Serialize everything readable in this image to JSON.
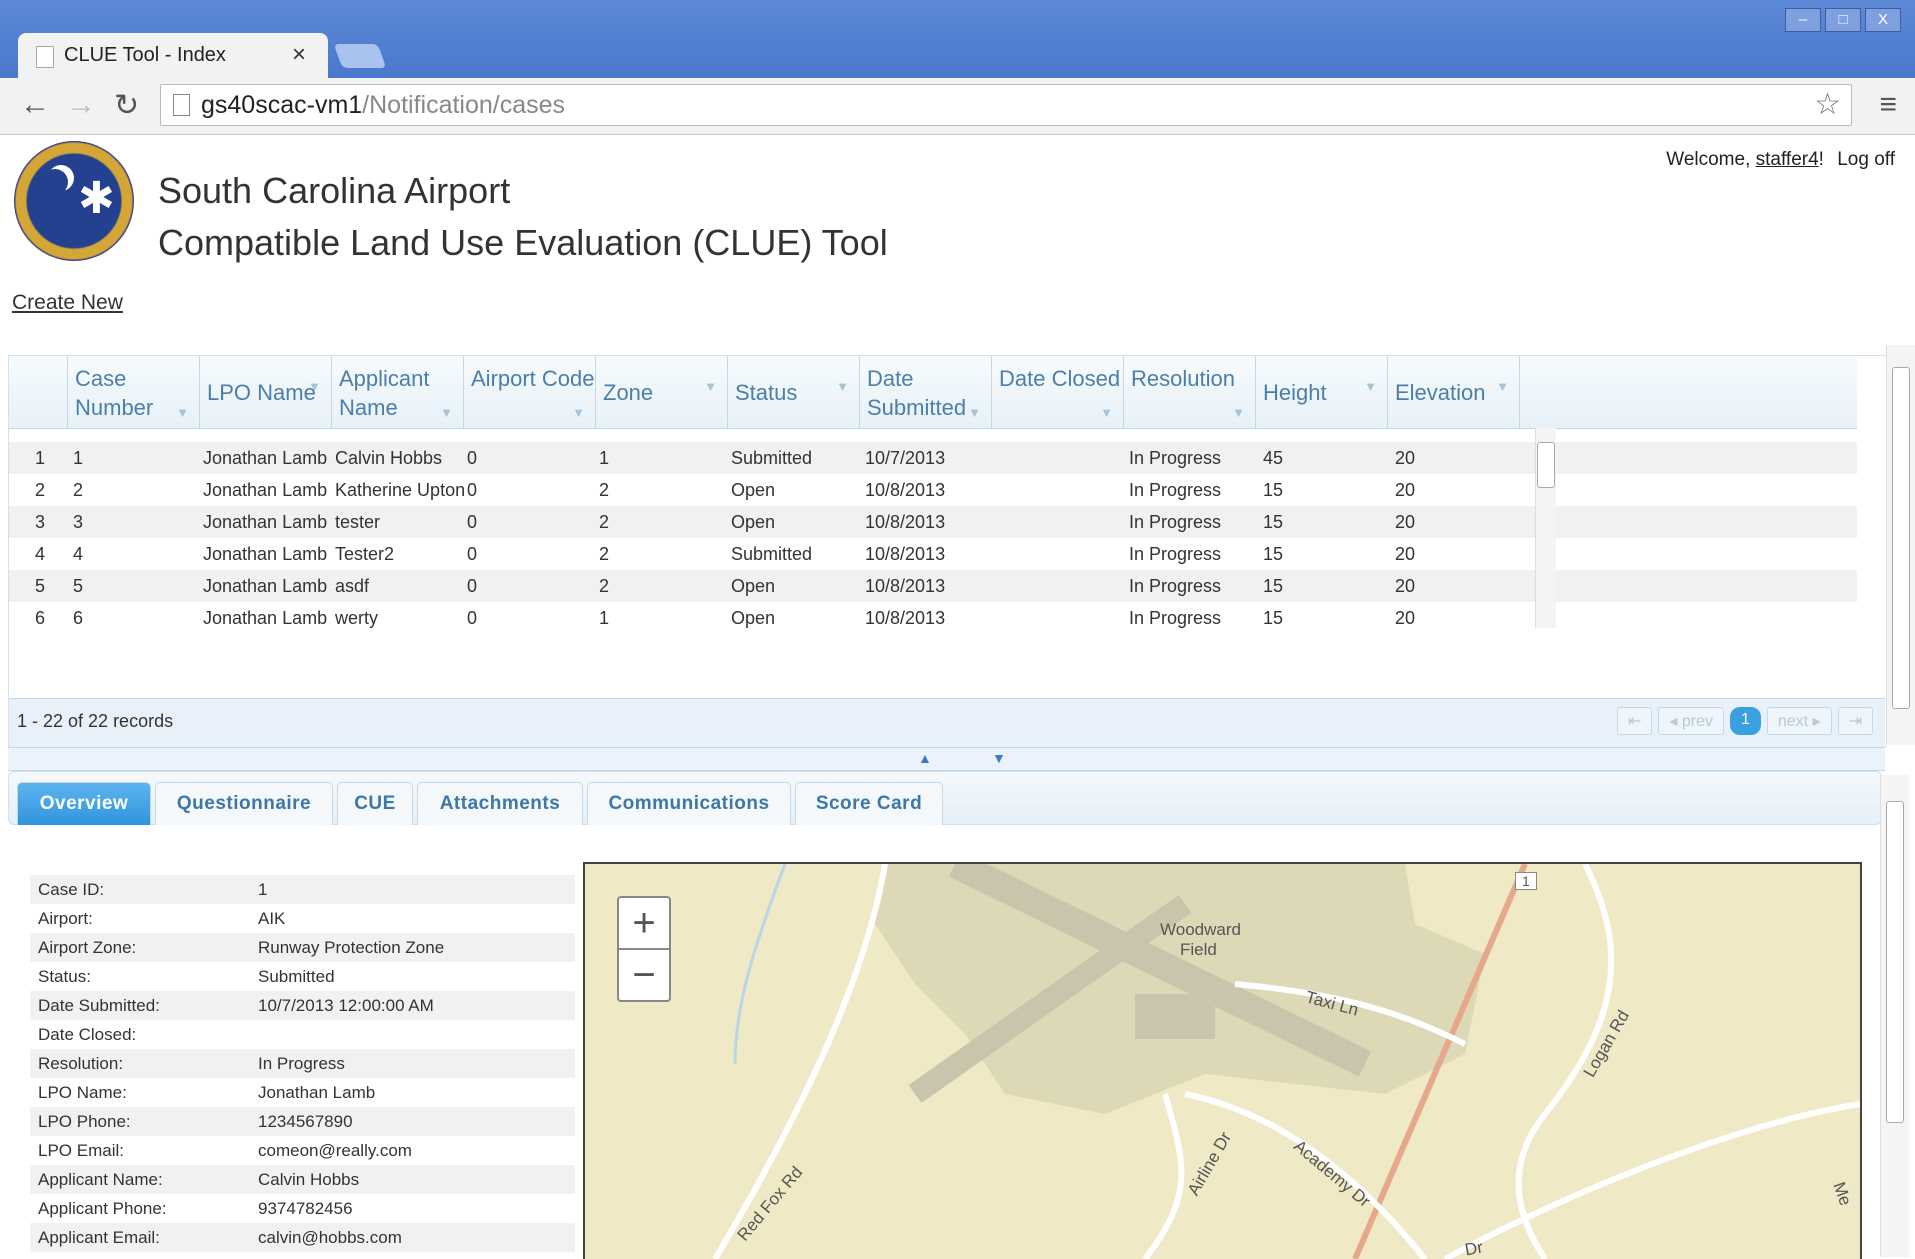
{
  "browser": {
    "tab_title": "CLUE Tool - Index",
    "tab_close": "×",
    "url_host": "gs40scac-vm1",
    "url_path": "/Notification/cases",
    "window_buttons": [
      "–",
      "□",
      "X"
    ]
  },
  "header": {
    "title_line1": "South Carolina Airport",
    "title_line2": "Compatible Land Use Evaluation (CLUE) Tool",
    "welcome_prefix": "Welcome, ",
    "username": "staffer4",
    "welcome_suffix": "!",
    "logoff": "Log off"
  },
  "actions": {
    "create_new": "Create New"
  },
  "grid": {
    "columns": [
      "Case Number",
      "LPO Name",
      "Applicant Name",
      "Airport Code",
      "Zone",
      "Status",
      "Date Submitted",
      "Date Closed",
      "Resolution",
      "Height",
      "Elevation"
    ],
    "rows": [
      {
        "idx": "1",
        "case": "1",
        "lpo": "Jonathan Lamb",
        "applicant": "Calvin Hobbs",
        "airport": "0",
        "zone": "1",
        "status": "Submitted",
        "submitted": "10/7/2013",
        "closed": "",
        "resolution": "In Progress",
        "height": "45",
        "elevation": "20"
      },
      {
        "idx": "2",
        "case": "2",
        "lpo": "Jonathan Lamb",
        "applicant": "Katherine Upton",
        "airport": "0",
        "zone": "2",
        "status": "Open",
        "submitted": "10/8/2013",
        "closed": "",
        "resolution": "In Progress",
        "height": "15",
        "elevation": "20"
      },
      {
        "idx": "3",
        "case": "3",
        "lpo": "Jonathan Lamb",
        "applicant": "tester",
        "airport": "0",
        "zone": "2",
        "status": "Open",
        "submitted": "10/8/2013",
        "closed": "",
        "resolution": "In Progress",
        "height": "15",
        "elevation": "20"
      },
      {
        "idx": "4",
        "case": "4",
        "lpo": "Jonathan Lamb",
        "applicant": "Tester2",
        "airport": "0",
        "zone": "2",
        "status": "Submitted",
        "submitted": "10/8/2013",
        "closed": "",
        "resolution": "In Progress",
        "height": "15",
        "elevation": "20"
      },
      {
        "idx": "5",
        "case": "5",
        "lpo": "Jonathan Lamb",
        "applicant": "asdf",
        "airport": "0",
        "zone": "2",
        "status": "Open",
        "submitted": "10/8/2013",
        "closed": "",
        "resolution": "In Progress",
        "height": "15",
        "elevation": "20"
      },
      {
        "idx": "6",
        "case": "6",
        "lpo": "Jonathan Lamb",
        "applicant": "werty",
        "airport": "0",
        "zone": "1",
        "status": "Open",
        "submitted": "10/8/2013",
        "closed": "",
        "resolution": "In Progress",
        "height": "15",
        "elevation": "20"
      }
    ],
    "records_text": "1 - 22 of 22 records",
    "pager": {
      "first": "⇤",
      "prev": "◂ prev",
      "current": "1",
      "next": "next ▸",
      "last": "⇥"
    }
  },
  "detail_tabs": [
    "Overview",
    "Questionnaire",
    "CUE",
    "Attachments",
    "Communications",
    "Score Card"
  ],
  "overview": [
    {
      "k": "Case ID:",
      "v": "1"
    },
    {
      "k": "Airport:",
      "v": "AIK"
    },
    {
      "k": "Airport Zone:",
      "v": "Runway Protection Zone"
    },
    {
      "k": "Status:",
      "v": "Submitted"
    },
    {
      "k": "Date Submitted:",
      "v": "10/7/2013 12:00:00 AM"
    },
    {
      "k": "Date Closed:",
      "v": ""
    },
    {
      "k": "Resolution:",
      "v": "In Progress"
    },
    {
      "k": "LPO Name:",
      "v": "Jonathan Lamb"
    },
    {
      "k": "LPO Phone:",
      "v": "1234567890"
    },
    {
      "k": "LPO Email:",
      "v": "comeon@really.com"
    },
    {
      "k": "Applicant Name:",
      "v": "Calvin Hobbs"
    },
    {
      "k": "Applicant Phone:",
      "v": "9374782456"
    },
    {
      "k": "Applicant Email:",
      "v": "calvin@hobbs.com"
    }
  ],
  "map": {
    "zoom_in": "+",
    "zoom_out": "−",
    "labels": [
      "Woodward",
      "Field",
      "Taxi Ln",
      "Logan Rd",
      "Airline Dr",
      "Academy Dr",
      "Red Fox Rd",
      "1",
      "Dr",
      "Me"
    ]
  },
  "colors": {
    "accent": "#2f94dd",
    "grid_header_text": "#4b7fa8",
    "map_bg": "#efe9c5"
  }
}
